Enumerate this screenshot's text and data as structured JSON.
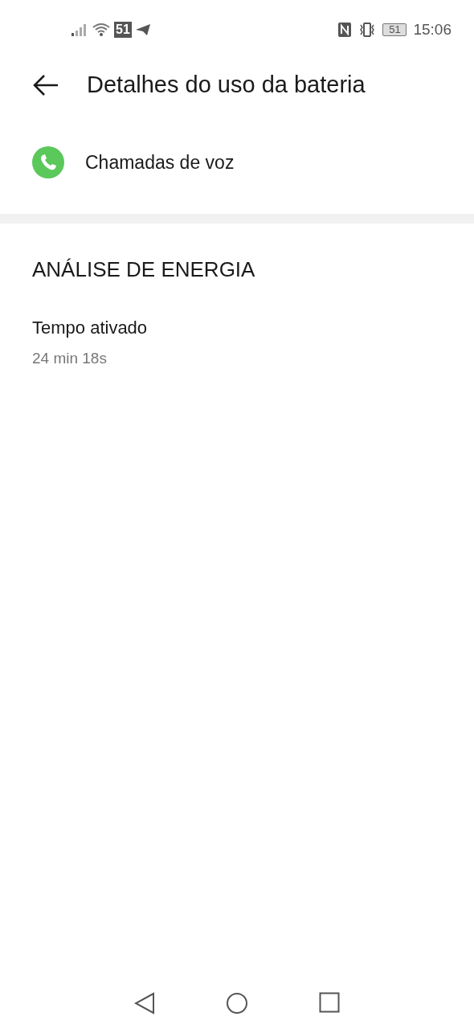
{
  "status_bar": {
    "notification_badge": "51",
    "battery": "51",
    "time": "15:06"
  },
  "header": {
    "title": "Detalhes do uso da bateria"
  },
  "app": {
    "name": "Chamadas de voz"
  },
  "section": {
    "title": "ANÁLISE DE ENERGIA",
    "items": [
      {
        "label": "Tempo ativado",
        "value": "24 min 18s"
      }
    ]
  }
}
